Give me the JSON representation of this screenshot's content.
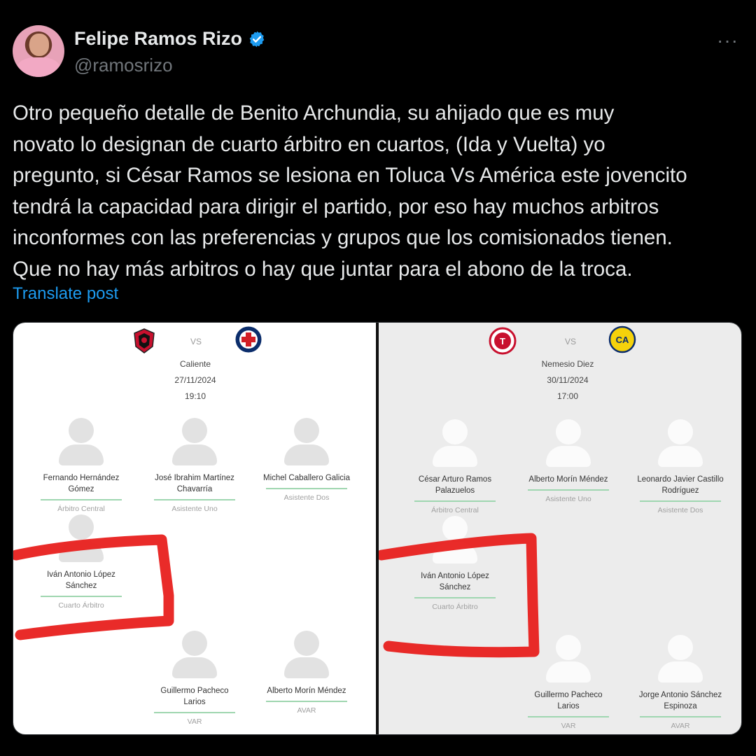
{
  "author": {
    "name": "Felipe Ramos Rizo",
    "handle": "@ramosrizo",
    "verified_color": "#1d9bf0"
  },
  "more_label": "···",
  "tweet": {
    "lines": [
      "Otro pequeño detalle de Benito Archundia, su ahijado que es muy",
      "novato lo designan de cuarto árbitro en cuartos, (Ida y Vuelta) yo",
      "pregunto, si César Ramos se lesiona en Toluca Vs América este jovencito",
      "tendrá la capacidad para dirigir el partido, por eso hay muchos arbitros",
      "inconformes con las preferencias y grupos que los comisionados tienen.",
      "Que no hay más arbitros o hay que juntar para el abono de la troca."
    ],
    "translate_label": "Translate post"
  },
  "left_match": {
    "vs": "VS",
    "venue": "Caliente",
    "date": "27/11/2024",
    "time": "19:10",
    "refs": [
      {
        "name": "Fernando Hernández Gómez",
        "role": "Árbitro Central"
      },
      {
        "name": "José Ibrahim Martínez Chavarría",
        "role": "Asistente Uno"
      },
      {
        "name": "Michel Caballero Galicia",
        "role": "Asistente Dos"
      },
      {
        "name": "Iván Antonio López Sánchez",
        "role": "Cuarto Árbitro"
      },
      {
        "name": "Guillermo Pacheco Larios",
        "role": "VAR"
      },
      {
        "name": "Alberto Morín Méndez",
        "role": "AVAR"
      }
    ]
  },
  "right_match": {
    "vs": "VS",
    "venue": "Nemesio Diez",
    "date": "30/11/2024",
    "time": "17:00",
    "refs": [
      {
        "name": "César Arturo Ramos Palazuelos",
        "role": "Árbitro Central"
      },
      {
        "name": "Alberto Morín Méndez",
        "role": "Asistente Uno"
      },
      {
        "name": "Leonardo Javier Castillo Rodríguez",
        "role": "Asistente Dos"
      },
      {
        "name": "Iván Antonio López Sánchez",
        "role": "Cuarto Árbitro"
      },
      {
        "name": "Guillermo Pacheco Larios",
        "role": "VAR"
      },
      {
        "name": "Jorge Antonio Sánchez Espinoza",
        "role": "AVAR"
      }
    ]
  },
  "colors": {
    "highlight_marker": "#e8201e",
    "link": "#1d9bf0"
  }
}
